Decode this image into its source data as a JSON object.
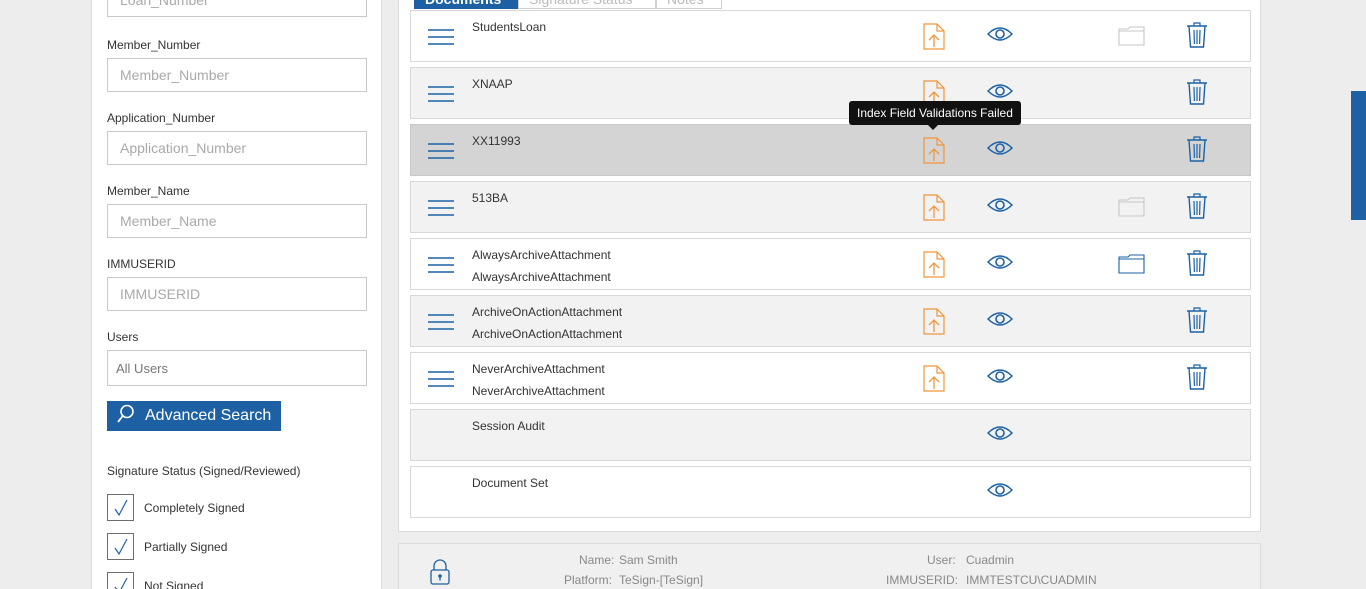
{
  "search": {
    "loan_number": {
      "placeholder": "Loan_Number"
    },
    "member_number": {
      "label": "Member_Number",
      "placeholder": "Member_Number"
    },
    "application_number": {
      "label": "Application_Number",
      "placeholder": "Application_Number"
    },
    "member_name": {
      "label": "Member_Name",
      "placeholder": "Member_Name"
    },
    "immuserid": {
      "label": "IMMUSERID",
      "placeholder": "IMMUSERID"
    },
    "users": {
      "label": "Users",
      "value": "All Users"
    },
    "advanced_search_label": "Advanced Search"
  },
  "signature_status": {
    "title": "Signature Status (Signed/Reviewed)",
    "options": [
      {
        "label": "Completely Signed",
        "checked": true
      },
      {
        "label": "Partially Signed",
        "checked": true
      },
      {
        "label": "Not Signed",
        "checked": true
      }
    ]
  },
  "tabs": [
    {
      "label": "Documents",
      "active": true
    },
    {
      "label": "Signature Status",
      "active": false
    },
    {
      "label": "Notes",
      "active": false
    }
  ],
  "documents": [
    {
      "title": "StudentsLoan",
      "subtitle": "",
      "upload": true,
      "folder": true,
      "trash": true
    },
    {
      "title": "XNAAP",
      "subtitle": "",
      "upload": true,
      "folder": false,
      "trash": true
    },
    {
      "title": "XX11993",
      "subtitle": "",
      "upload": true,
      "folder": false,
      "trash": true
    },
    {
      "title": "513BA",
      "subtitle": "",
      "upload": true,
      "folder": true,
      "trash": true
    },
    {
      "title": "AlwaysArchiveAttachment",
      "subtitle": "AlwaysArchiveAttachment",
      "upload": true,
      "folder": true,
      "trash": true
    },
    {
      "title": "ArchiveOnActionAttachment",
      "subtitle": "ArchiveOnActionAttachment",
      "upload": true,
      "folder": false,
      "trash": true
    },
    {
      "title": "NeverArchiveAttachment",
      "subtitle": "NeverArchiveAttachment",
      "upload": true,
      "folder": false,
      "trash": true
    },
    {
      "title": "Session Audit",
      "subtitle": "",
      "upload": false,
      "folder": false,
      "trash": false
    },
    {
      "title": "Document Set",
      "subtitle": "",
      "upload": false,
      "folder": false,
      "trash": false
    }
  ],
  "tooltip": "Index Field Validations Failed",
  "info": {
    "name_label": "Name:",
    "name_value": "Sam Smith",
    "platform_label": "Platform:",
    "platform_value": "TeSign-[TeSign]",
    "user_label": "User:",
    "user_value": "Cuadmin",
    "immuserid_label": "IMMUSERID:",
    "immuserid_value": "IMMTESTCU\\CUADMIN"
  },
  "colors": {
    "accent": "#1d61a4",
    "upload_orange": "#f0963c",
    "highlight_row": "#d4d4d4"
  }
}
